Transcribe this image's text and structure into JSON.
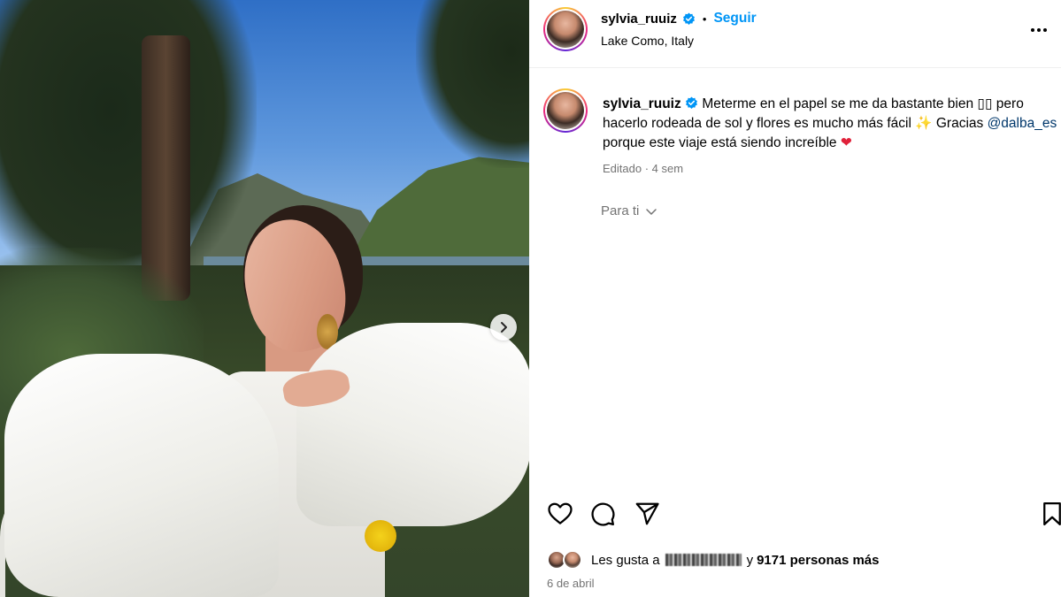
{
  "post": {
    "username": "sylvia_ruuiz",
    "follow_label": "Seguir",
    "dot": "•",
    "location": "Lake Como, Italy",
    "caption": {
      "text1": " Meterme en el papel se me da bastante bien ▯▯ pero hacerlo rodeada de sol y flores es mucho más fácil ",
      "sparkle": "✨",
      "text2": " Gracias ",
      "mention": "@dalba_es",
      "text3": " porque este viaje está siendo increíble ",
      "heart": "❤"
    },
    "meta": "Editado · 4 sem",
    "for_you_label": "Para ti",
    "likes": {
      "prefix": "Les gusta a",
      "conjunction": "y",
      "count_text": "9171 personas más"
    },
    "date": "6 de abril"
  },
  "icons": {
    "verified": "verified-badge-icon",
    "more": "more-options-icon",
    "like": "heart-icon",
    "comment": "comment-icon",
    "share": "send-icon",
    "save": "bookmark-icon",
    "next": "chevron-right-icon",
    "for_you_chevron": "chevron-down-icon"
  },
  "colors": {
    "accent": "#0095f6",
    "mention": "#00376b",
    "muted": "#737373"
  }
}
